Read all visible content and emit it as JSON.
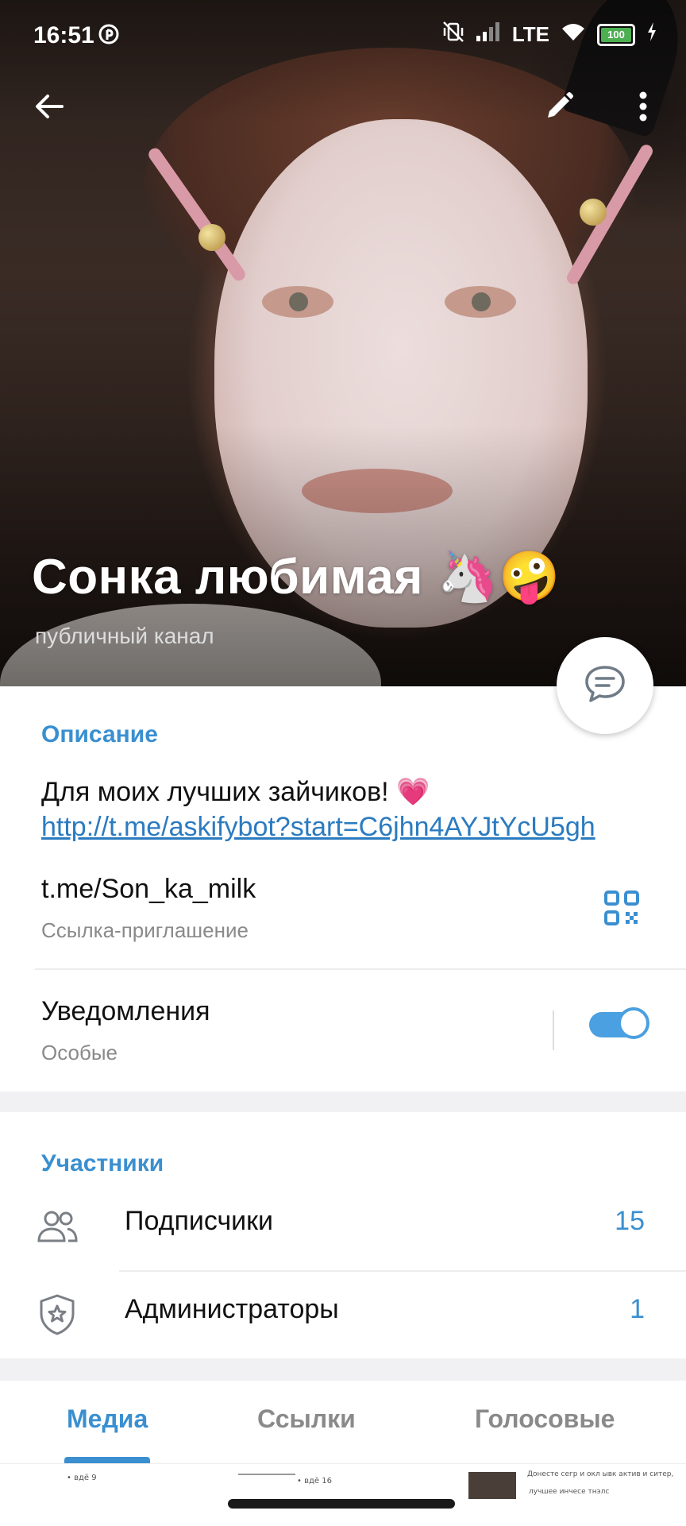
{
  "status_bar": {
    "time": "16:51",
    "network": "LTE",
    "battery": "100",
    "icons": [
      "pinterest-icon",
      "no-vibration-icon",
      "signal-icon",
      "wifi-icon",
      "battery-icon",
      "charging-icon"
    ]
  },
  "header": {
    "channel_name": "Сонка любимая 🦄🤪",
    "channel_type": "публичный канал",
    "icons": [
      "back-arrow-icon",
      "pencil-icon",
      "more-vertical-icon",
      "chat-bubble-icon"
    ]
  },
  "description": {
    "title": "Описание",
    "text": "Для моих лучших зайчиков! 💗",
    "link": "http://t.me/askifybot?start=C6jhn4AYJtYcU5gh"
  },
  "invite": {
    "link": "t.me/Son_ka_milk",
    "label": "Ссылка-приглашение"
  },
  "notifications": {
    "title": "Уведомления",
    "value": "Особые",
    "enabled": true
  },
  "members": {
    "title": "Участники",
    "items": [
      {
        "label": "Подписчики",
        "count": "15",
        "icon": "people-icon"
      },
      {
        "label": "Администраторы",
        "count": "1",
        "icon": "shield-star-icon"
      }
    ]
  },
  "tabs": {
    "items": [
      "Медиа",
      "Ссылки",
      "Голосовые"
    ],
    "active": "Медиа"
  },
  "media_strip": {
    "thumb1_caption": "• вдё 9",
    "thumb2_caption": "• вдё 16",
    "thumb3_line1": "Донесте сегр и окл ывк актив и ситер,",
    "thumb3_line2": "лучшее    инчесе    тнэлс"
  },
  "colors": {
    "accent": "#3a8fd0",
    "link": "#2b7bc0",
    "toggle": "#4aa0e0",
    "battery": "#4caf50"
  }
}
